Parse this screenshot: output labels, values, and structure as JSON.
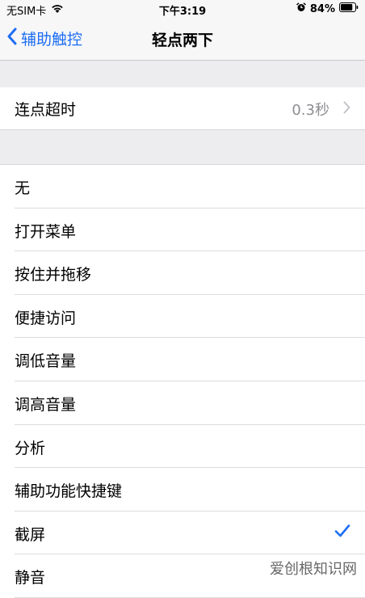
{
  "status_bar": {
    "carrier": "无SIM卡",
    "time": "下午3:19",
    "battery": "84%"
  },
  "nav": {
    "back_label": "辅助触控",
    "title": "轻点两下"
  },
  "timeout": {
    "label": "连点超时",
    "value": "0.3秒"
  },
  "options": [
    {
      "label": "无",
      "selected": false
    },
    {
      "label": "打开菜单",
      "selected": false
    },
    {
      "label": "按住并拖移",
      "selected": false
    },
    {
      "label": "便捷访问",
      "selected": false
    },
    {
      "label": "调低音量",
      "selected": false
    },
    {
      "label": "调高音量",
      "selected": false
    },
    {
      "label": "分析",
      "selected": false
    },
    {
      "label": "辅助功能快捷键",
      "selected": false
    },
    {
      "label": "截屏",
      "selected": true
    },
    {
      "label": "静音",
      "selected": false
    }
  ],
  "watermark": "爱创根知识网",
  "colors": {
    "accent": "#1e6ef5",
    "secondary_text": "#8e8e93",
    "background": "#f2f2f7"
  }
}
